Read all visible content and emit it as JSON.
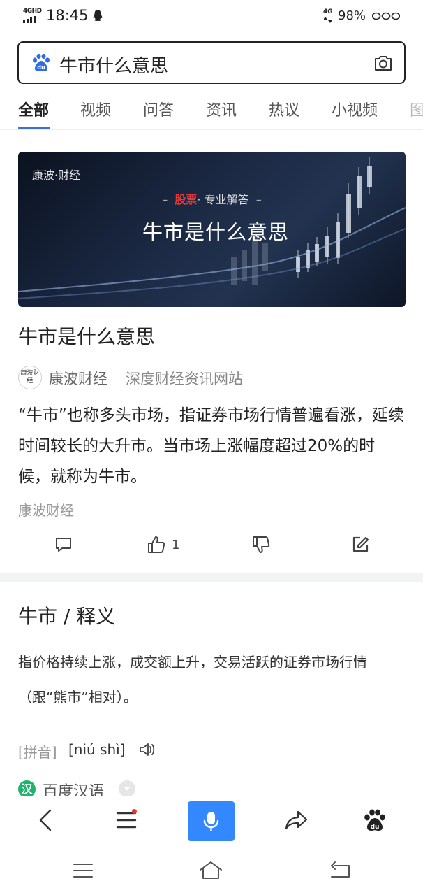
{
  "status_bar": {
    "network_tag": "4GHD",
    "time": "18:45",
    "network_right": "4G",
    "battery": "98%"
  },
  "search": {
    "query": "牛市什么意思"
  },
  "tabs": [
    {
      "label": "全部",
      "active": true
    },
    {
      "label": "视频"
    },
    {
      "label": "问答"
    },
    {
      "label": "资讯"
    },
    {
      "label": "热议"
    },
    {
      "label": "小视频"
    },
    {
      "label": "图"
    }
  ],
  "result1": {
    "banner": {
      "brand": "康波·财经",
      "sub_red": "股票",
      "sub_rest": "· 专业解答",
      "title": "牛市是什么意思"
    },
    "title": "牛市是什么意思",
    "source_avatar": "康波财经",
    "source_name": "康波财经",
    "source_desc": "深度财经资讯网站",
    "snippet": "“牛市”也称多头市场，指证券市场行情普遍看涨，延续时间较长的大升市。当市场上涨幅度超过20%的时候，就称为牛市。",
    "snippet_source": "康波财经",
    "like_count": "1"
  },
  "result2": {
    "title": "牛市 / 释义",
    "definition": "指价格持续上涨，成交额上升，交易活跃的证券市场行情（跟“熊市”相对）。",
    "pinyin_label": "[拼音]",
    "pinyin_value": "[niú shì]",
    "source_icon": "汉",
    "source_name": "百度汉语"
  },
  "icons": {
    "accent": "#3a6de0",
    "mic_bg": "#3388ff",
    "badge": "#ee3333",
    "hanyu_green": "#21b26c"
  }
}
